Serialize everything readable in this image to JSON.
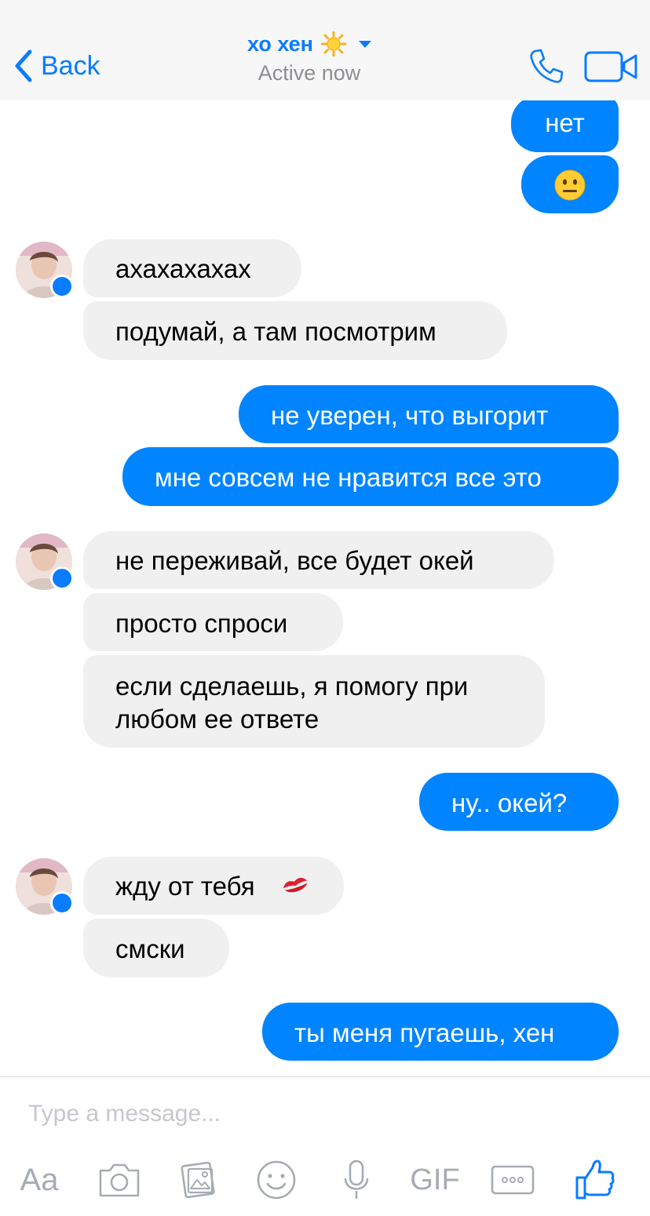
{
  "header": {
    "back_label": "Back",
    "contact_name": "хо хен",
    "status": "Active now"
  },
  "messages": [
    {
      "side": "outgoing",
      "text": "нет"
    },
    {
      "side": "outgoing",
      "emoji": "neutral-face"
    },
    {
      "side": "incoming",
      "text": "ахахахахах"
    },
    {
      "side": "incoming",
      "text": "подумай, а там посмотрим"
    },
    {
      "side": "outgoing",
      "text": "не уверен, что выгорит"
    },
    {
      "side": "outgoing",
      "text": "мне совсем не нравится все это"
    },
    {
      "side": "incoming",
      "text": "не переживай, все будет окей"
    },
    {
      "side": "incoming",
      "text": "просто спроси"
    },
    {
      "side": "incoming",
      "text": "если сделаешь, я помогу при любом ее ответе"
    },
    {
      "side": "outgoing",
      "text": "ну.. окей?"
    },
    {
      "side": "incoming",
      "text": "жду от тебя",
      "emoji": "kiss-mark"
    },
    {
      "side": "incoming",
      "text": "смски"
    },
    {
      "side": "outgoing",
      "text": "ты меня пугаешь, хен"
    }
  ],
  "composer": {
    "placeholder": "Type a message...",
    "aa_label": "Aa",
    "gif_label": "GIF"
  },
  "colors": {
    "accent": "#0084ff",
    "incoming_bubble": "#f1f0f0",
    "header_bg": "#f7f7f7",
    "icon_gray": "#a7abb3"
  },
  "icons": [
    "chevron-left-icon",
    "sun-icon",
    "caret-down-icon",
    "phone-icon",
    "video-camera-icon",
    "messenger-badge-icon",
    "camera-icon",
    "photo-icon",
    "smiley-icon",
    "microphone-icon",
    "more-icon",
    "thumbs-up-icon"
  ]
}
